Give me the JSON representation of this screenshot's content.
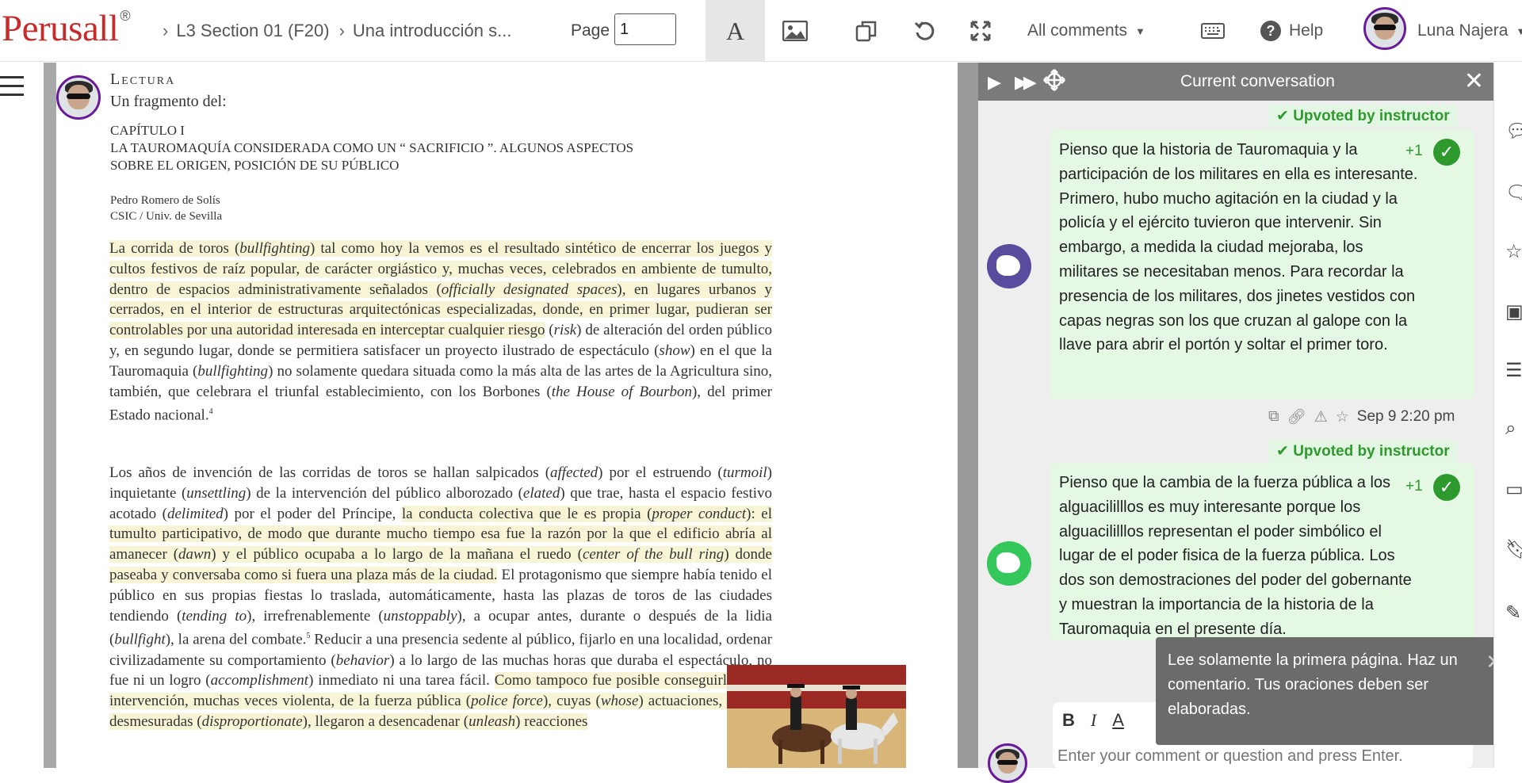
{
  "app": {
    "logo": "Perusall",
    "logo_mark": "®"
  },
  "breadcrumb": {
    "course": "L3 Section 01 (F20)",
    "document": "Una introducción s..."
  },
  "toolbar": {
    "page_label": "Page",
    "page_value": "1",
    "text_mode_glyph": "A",
    "comments_filter": "All comments",
    "help_label": "Help",
    "user_name": "Luna Najera"
  },
  "document": {
    "lectura": "Lectura",
    "fragmento": "Un fragmento del:",
    "chapter_line1": "CAPÍTULO I",
    "chapter_line2": "LA TAUROMAQUÍA CONSIDERADA COMO UN “ SACRIFICIO ”. ALGUNOS ASPECTOS",
    "chapter_line3": "SOBRE EL ORIGEN, POSICIÓN DE SU PÚBLICO",
    "author_name": "Pedro Romero de Solís",
    "author_affil": "CSIC / Univ. de Sevilla"
  },
  "conversation": {
    "title": "Current conversation",
    "comments": [
      {
        "badge": "Upvoted by instructor",
        "upvotes": "+1",
        "text": "Pienso que la historia de Tauromaquia y la participación de los militares en ella es interesante. Primero, hubo mucho agitación en la ciudad y la policía y el ejército tuvieron que intervenir. Sin embargo, a medida la ciudad mejoraba, los militares se necesitaban menos. Para recordar la presencia de los militares, dos jinetes vestidos con capas negras son los que cruzan al galope con la llave para abrir el portón y soltar el primer toro.",
        "timestamp": "Sep 9 2:20 pm",
        "avatar_color": "#5b4b9e"
      },
      {
        "badge": "Upvoted by instructor",
        "upvotes": "+1",
        "text": "Pienso que la cambia de la fuerza pública a los alguacililllos es muy interesante porque los alguacililllos representan el poder simbólico el lugar de el poder fisica de la fuerza pública. Los dos son demostraciones del poder del gobernante y muestran la importancia de la historia de la Tauromaquia en el presente día.",
        "avatar_color": "#34c759"
      }
    ],
    "composer_placeholder": "Enter your comment or question and press Enter.",
    "format_bold": "B",
    "format_italic": "I",
    "format_color": "A"
  },
  "toast": {
    "text": "Lee solamente la primera página. Haz un comentario. Tus oraciones deben ser elaboradas.",
    "close": "✕"
  },
  "colors": {
    "accent": "#c92a2a",
    "highlight": "#f8f5d6",
    "comment_bg": "#e4f8e4",
    "upvote_green": "#2e9a2e",
    "avatar_ring": "#6a1b9a"
  }
}
